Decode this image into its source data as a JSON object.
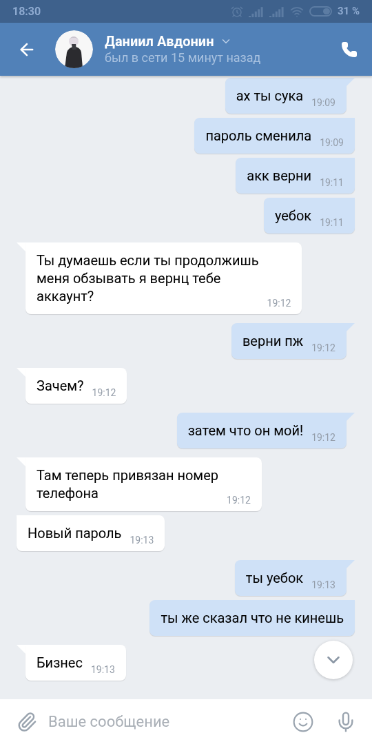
{
  "status_bar": {
    "time": "18:30",
    "battery": "31 %"
  },
  "header": {
    "name": "Даниил Авдонин",
    "status": "был в сети 15 минут назад"
  },
  "messages": [
    {
      "kind": "outgoing",
      "text": "ах ты сука",
      "time": "19:09"
    },
    {
      "kind": "outgoing",
      "text": "пароль сменила",
      "time": "19:09"
    },
    {
      "kind": "outgoing",
      "text": "акк верни",
      "time": "19:11"
    },
    {
      "kind": "outgoing",
      "text": "уебок",
      "time": "19:11"
    },
    {
      "kind": "incoming",
      "text": "Ты думаешь если ты продолжишь\nменя обзывать я вернц тебе\nаккаунт?",
      "time": "19:12"
    },
    {
      "kind": "outgoing",
      "text": "верни пж",
      "time": "19:12"
    },
    {
      "kind": "incoming",
      "text": "Зачем?",
      "time": "19:12"
    },
    {
      "kind": "outgoing",
      "text": "затем что он мой!",
      "time": "19:12"
    },
    {
      "kind": "incoming",
      "text": "Там теперь привязан номер\nтелефона",
      "time": "19:12"
    },
    {
      "kind": "incoming",
      "text": "Новый пароль",
      "time": "19:13"
    },
    {
      "kind": "outgoing",
      "text": "ты уебок",
      "time": "19:13"
    },
    {
      "kind": "outgoing",
      "text": "ты же сказал что не кинешь"
    },
    {
      "kind": "incoming",
      "text": "Бизнес",
      "time": "19:13"
    }
  ],
  "composer": {
    "placeholder": "Ваше сообщение"
  }
}
